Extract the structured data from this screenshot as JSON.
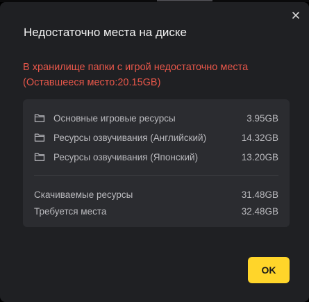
{
  "dialog": {
    "title": "Недостаточно места на диске",
    "close_icon": "close-icon",
    "warning_line1": "В хранилище папки с игрой недостаточно места",
    "warning_line2": "(Оставшееся место:20.15GB)",
    "warning_color": "#e8574a",
    "resources": [
      {
        "icon": "folder-icon",
        "label": "Основные игровые ресурсы",
        "size": "3.95GB"
      },
      {
        "icon": "folder-icon",
        "label": "Ресурсы озвучивания (Английский)",
        "size": "14.32GB"
      },
      {
        "icon": "folder-icon",
        "label": "Ресурсы озвучивания (Японский)",
        "size": "13.20GB"
      }
    ],
    "summary": [
      {
        "label": "Скачиваемые ресурсы",
        "value": "31.48GB"
      },
      {
        "label": "Требуется места",
        "value": "32.48GB"
      }
    ],
    "ok_label": "OK",
    "accent_color": "#ffd52a"
  }
}
